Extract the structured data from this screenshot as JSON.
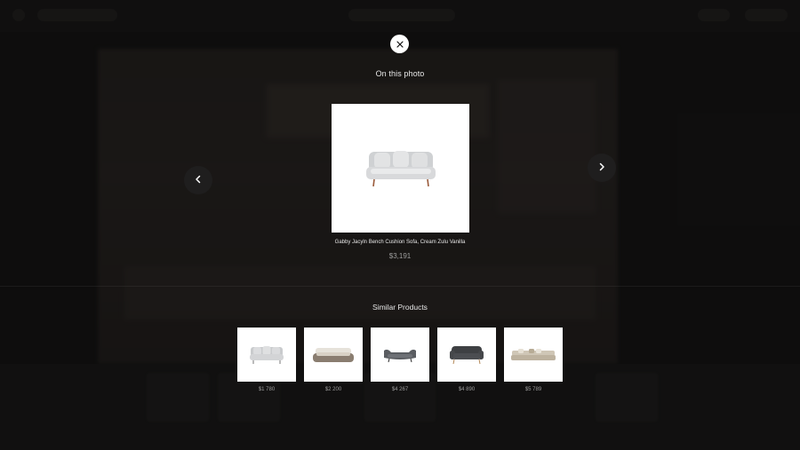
{
  "header": {
    "title": "On this photo"
  },
  "product": {
    "name": "Gabby Jacyln Bench Cushion Sofa, Cream Zulu Vanilla",
    "price": "$3,191"
  },
  "similar": {
    "title": "Similar Products",
    "items": [
      {
        "price": "$1 780",
        "sofa": "light-grey"
      },
      {
        "price": "$2 200",
        "sofa": "taupe"
      },
      {
        "price": "$4 267",
        "sofa": "dark-grey-curved"
      },
      {
        "price": "$4 890",
        "sofa": "charcoal"
      },
      {
        "price": "$5 789",
        "sofa": "beige-modular"
      }
    ]
  },
  "icons": {
    "close": "close-icon",
    "prev": "chevron-left-icon",
    "next": "chevron-right-icon"
  },
  "colors": {
    "overlay": "#141312",
    "card": "#ffffff",
    "price": "#9d9d9d"
  }
}
